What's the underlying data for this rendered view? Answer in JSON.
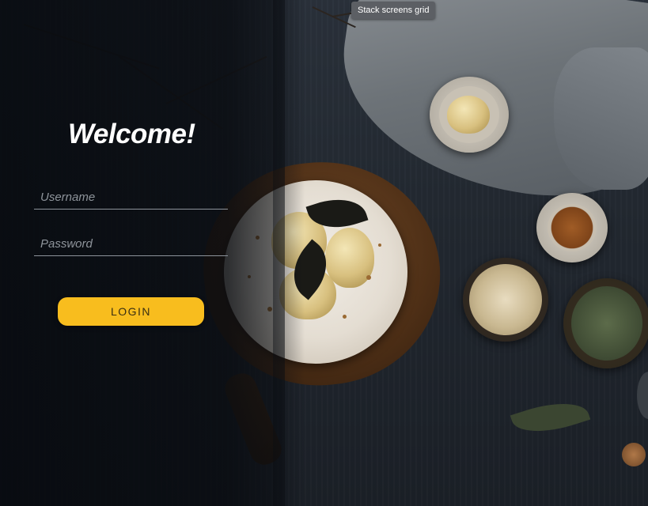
{
  "tooltip": {
    "text": "Stack screens grid"
  },
  "login": {
    "title": "Welcome!",
    "username_placeholder": "Username",
    "password_placeholder": "Password",
    "button_label": "LOGIN"
  },
  "colors": {
    "accent": "#f8bd1e",
    "panel": "#0a0d12",
    "field_underline": "#8d939b"
  }
}
